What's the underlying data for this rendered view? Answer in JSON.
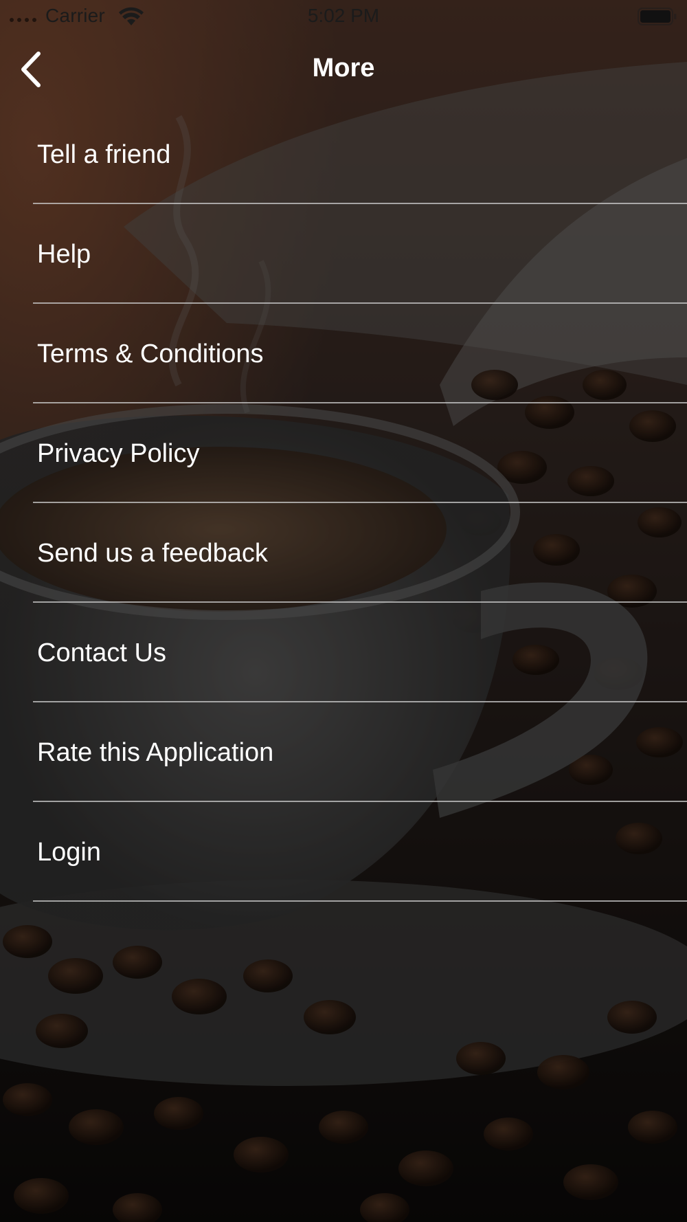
{
  "status_bar": {
    "carrier": "Carrier",
    "time": "5:02 PM",
    "wifi_icon": "wifi-icon",
    "battery_icon": "battery-icon"
  },
  "nav": {
    "title": "More",
    "back_icon": "chevron-left-icon"
  },
  "menu": {
    "items": [
      {
        "label": "Tell a friend"
      },
      {
        "label": "Help"
      },
      {
        "label": "Terms & Conditions"
      },
      {
        "label": "Privacy Policy"
      },
      {
        "label": "Send us a feedback"
      },
      {
        "label": "Contact Us"
      },
      {
        "label": "Rate this Application"
      },
      {
        "label": "Login"
      }
    ]
  },
  "background": {
    "image": "coffee-cup-and-beans-photo",
    "overlay_color": "#000000"
  }
}
